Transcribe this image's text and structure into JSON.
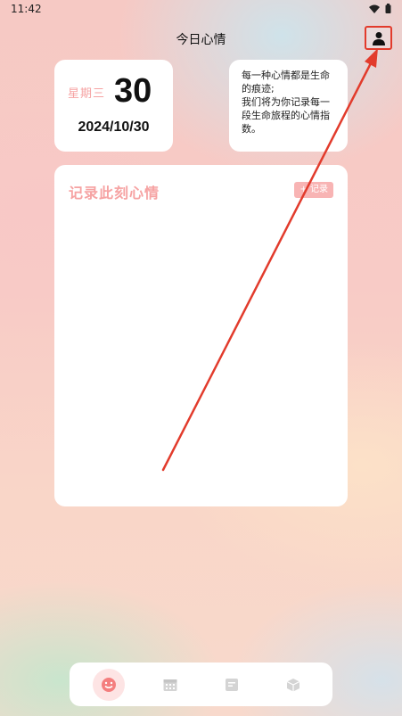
{
  "status_bar": {
    "time": "11:42"
  },
  "header": {
    "title": "今日心情"
  },
  "date_card": {
    "weekday": "星期三",
    "day": "30",
    "date": "2024/10/30"
  },
  "quote_card": {
    "text": "每一种心情都是生命的痕迹;\n我们将为你记录每一段生命旅程的心情指数。"
  },
  "record_card": {
    "title": "记录此刻心情",
    "button_label": "+ 记录"
  },
  "bottom_nav": {
    "items": [
      {
        "icon": "smiley-icon",
        "active": true
      },
      {
        "icon": "calendar-icon",
        "active": false
      },
      {
        "icon": "notes-icon",
        "active": false
      },
      {
        "icon": "box-icon",
        "active": false
      }
    ]
  },
  "colors": {
    "accent_pink": "#f6a2a2",
    "annotation_red": "#e23b2c"
  }
}
